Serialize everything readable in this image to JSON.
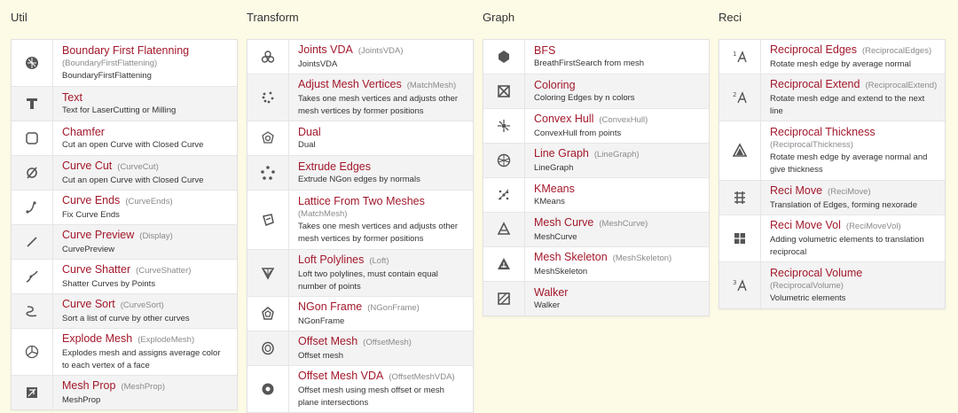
{
  "columns": [
    {
      "title": "Util",
      "items": [
        {
          "icon": "grid-ball-icon",
          "name": "Boundary First Flatenning",
          "alias": "(BoundaryFirstFlattening)",
          "alias_block": true,
          "desc": "BoundaryFirstFlattening"
        },
        {
          "icon": "text-icon",
          "name": "Text",
          "alias": "",
          "alias_block": false,
          "desc": "Text for LaserCutting or Milling"
        },
        {
          "icon": "chamfer-icon",
          "name": "Chamfer",
          "alias": "",
          "alias_block": false,
          "desc": "Cut an open Curve with Closed Curve"
        },
        {
          "icon": "curve-cut-icon",
          "name": "Curve Cut",
          "alias": "(CurveCut)",
          "alias_block": false,
          "desc": "Cut an open Curve with Closed Curve"
        },
        {
          "icon": "curve-ends-icon",
          "name": "Curve Ends",
          "alias": "(CurveEnds)",
          "alias_block": false,
          "desc": "Fix Curve Ends"
        },
        {
          "icon": "curve-preview-icon",
          "name": "Curve Preview",
          "alias": "(Display)",
          "alias_block": false,
          "desc": "CurvePreview"
        },
        {
          "icon": "curve-shatter-icon",
          "name": "Curve Shatter",
          "alias": "(CurveShatter)",
          "alias_block": false,
          "desc": "Shatter Curves by Points"
        },
        {
          "icon": "curve-sort-icon",
          "name": "Curve Sort",
          "alias": "(CurveSort)",
          "alias_block": false,
          "desc": "Sort a list of curve by other curves"
        },
        {
          "icon": "explode-mesh-icon",
          "name": "Explode Mesh",
          "alias": "(ExplodeMesh)",
          "alias_block": false,
          "desc": "Explodes mesh and assigns average color to each vertex of a face"
        },
        {
          "icon": "mesh-prop-icon",
          "name": "Mesh Prop",
          "alias": "(MeshProp)",
          "alias_block": false,
          "desc": "MeshProp"
        }
      ]
    },
    {
      "title": "Transform",
      "items": [
        {
          "icon": "joints-vda-icon",
          "name": "Joints VDA",
          "alias": "(JointsVDA)",
          "alias_block": false,
          "desc": "JointsVDA"
        },
        {
          "icon": "adjust-vertices-icon",
          "name": "Adjust Mesh Vertices",
          "alias": "(MatchMesh)",
          "alias_block": false,
          "desc": "Takes one mesh vertices and adjusts other mesh vertices by former positions"
        },
        {
          "icon": "dual-icon",
          "name": "Dual",
          "alias": "",
          "alias_block": false,
          "desc": "Dual"
        },
        {
          "icon": "extrude-edges-icon",
          "name": "Extrude Edges",
          "alias": "",
          "alias_block": false,
          "desc": "Extrude NGon edges by normals"
        },
        {
          "icon": "lattice-icon",
          "name": "Lattice From Two Meshes",
          "alias": "(MatchMesh)",
          "alias_block": true,
          "desc": "Takes one mesh vertices and adjusts other mesh vertices by former positions"
        },
        {
          "icon": "loft-polylines-icon",
          "name": "Loft Polylines",
          "alias": "(Loft)",
          "alias_block": false,
          "desc": "Loft two polylines, must contain equal number of points"
        },
        {
          "icon": "ngon-frame-icon",
          "name": "NGon Frame",
          "alias": "(NGonFrame)",
          "alias_block": false,
          "desc": "NGonFrame"
        },
        {
          "icon": "offset-mesh-icon",
          "name": "Offset Mesh",
          "alias": "(OffsetMesh)",
          "alias_block": false,
          "desc": "Offset mesh"
        },
        {
          "icon": "offset-mesh-vda-icon",
          "name": "Offset Mesh VDA",
          "alias": "(OffsetMeshVDA)",
          "alias_block": false,
          "desc": "Offset mesh using mesh offset or mesh plane intersections"
        }
      ]
    },
    {
      "title": "Graph",
      "items": [
        {
          "icon": "bfs-icon",
          "name": "BFS",
          "alias": "",
          "alias_block": false,
          "desc": "BreathFirstSearch from mesh"
        },
        {
          "icon": "coloring-icon",
          "name": "Coloring",
          "alias": "",
          "alias_block": false,
          "desc": "Coloring Edges by n colors"
        },
        {
          "icon": "convex-hull-icon",
          "name": "Convex Hull",
          "alias": "(ConvexHull)",
          "alias_block": false,
          "desc": "ConvexHull from points"
        },
        {
          "icon": "line-graph-icon",
          "name": "Line Graph",
          "alias": "(LineGraph)",
          "alias_block": false,
          "desc": "LineGraph"
        },
        {
          "icon": "kmeans-icon",
          "name": "KMeans",
          "alias": "",
          "alias_block": false,
          "desc": "KMeans"
        },
        {
          "icon": "mesh-curve-icon",
          "name": "Mesh Curve",
          "alias": "(MeshCurve)",
          "alias_block": false,
          "desc": "MeshCurve"
        },
        {
          "icon": "mesh-skeleton-icon",
          "name": "Mesh Skeleton",
          "alias": "(MeshSkeleton)",
          "alias_block": false,
          "desc": "MeshSkeleton"
        },
        {
          "icon": "walker-icon",
          "name": "Walker",
          "alias": "",
          "alias_block": false,
          "desc": "Walker"
        }
      ]
    },
    {
      "title": "Reci",
      "items": [
        {
          "icon": "reciprocal-edges-icon",
          "name": "Reciprocal Edges",
          "alias": "(ReciprocalEdges)",
          "alias_block": false,
          "desc": "Rotate mesh edge by average normal"
        },
        {
          "icon": "reciprocal-extend-icon",
          "name": "Reciprocal Extend",
          "alias": "(ReciprocalExtend)",
          "alias_block": false,
          "desc": "Rotate mesh edge and extend to the next line"
        },
        {
          "icon": "reciprocal-thickness-icon",
          "name": "Reciprocal Thickness",
          "alias": "(ReciprocalThickness)",
          "alias_block": true,
          "desc": "Rotate mesh edge by average normal and give thickness"
        },
        {
          "icon": "reci-move-icon",
          "name": "Reci Move",
          "alias": "(ReciMove)",
          "alias_block": false,
          "desc": "Translation of Edges, forming nexorade"
        },
        {
          "icon": "reci-move-vol-icon",
          "name": "Reci Move Vol",
          "alias": "(ReciMoveVol)",
          "alias_block": false,
          "desc": "Adding volumetric elements to translation reciprocal"
        },
        {
          "icon": "reciprocal-volume-icon",
          "name": "Reciprocal Volume",
          "alias": "(ReciprocalVolume)",
          "alias_block": true,
          "desc": "Volumetric elements"
        }
      ]
    }
  ],
  "colors": {
    "background": "#fdfbe6",
    "name": "#a3182b",
    "alias": "#8a8a8a",
    "desc": "#333333"
  }
}
